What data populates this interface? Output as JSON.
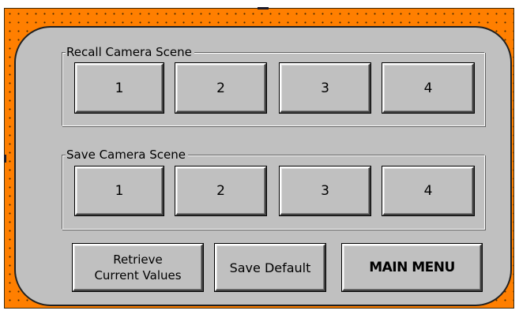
{
  "recall_group": {
    "label": "Recall Camera Scene",
    "buttons": [
      "1",
      "2",
      "3",
      "4"
    ]
  },
  "save_group": {
    "label": "Save Camera Scene",
    "buttons": [
      "1",
      "2",
      "3",
      "4"
    ]
  },
  "actions": {
    "retrieve_label": "Retrieve\nCurrent Values",
    "save_default_label": "Save Default",
    "main_menu_label": "MAIN MENU"
  },
  "colors": {
    "frame_background": "#ff7f00",
    "panel_background": "#c0c0c0",
    "button_face": "#c0c0c0"
  }
}
